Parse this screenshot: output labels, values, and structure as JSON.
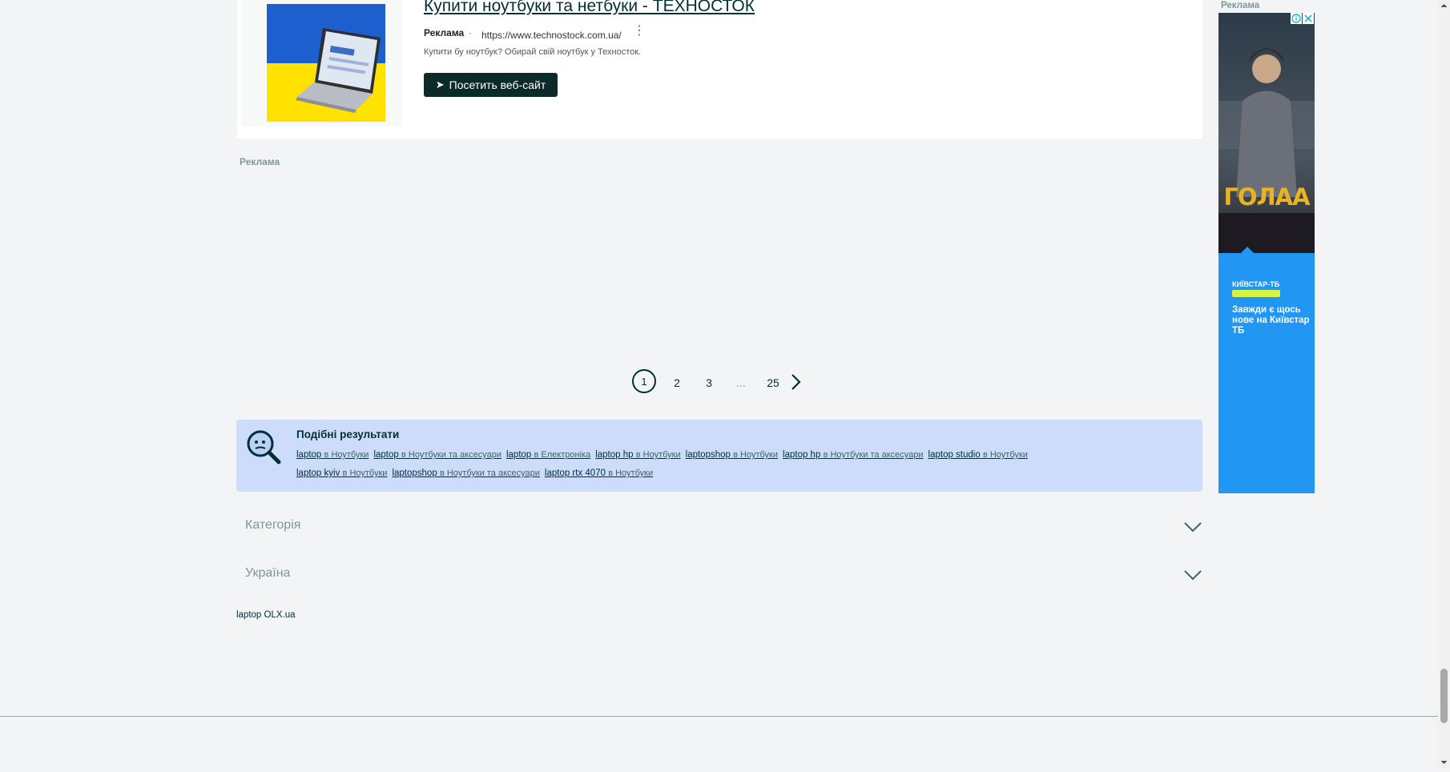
{
  "ad": {
    "title": "Купити ноутбуки та нетбуки - ТЕХНОСТОК",
    "label": "Реклама",
    "separator": "·",
    "url": "https://www.technostock.com.ua/",
    "description": "Купити бу ноутбук? Обирай свій ноутбук у Техносток.",
    "cta": "Посетить веб-сайт",
    "menu_icon": "more-vertical-icon"
  },
  "ad_section_label": "Реклама",
  "pagination": {
    "current": 1,
    "pages": [
      "1",
      "2",
      "3",
      "...",
      "25"
    ],
    "next_icon": "chevron-right-icon"
  },
  "similar": {
    "title": "Подібні результати",
    "icon": "search-face-icon",
    "row1": [
      {
        "q": "laptop",
        "in": "в Ноутбуки"
      },
      {
        "q": "laptop",
        "in": "в Ноутбуки та аксесуари"
      },
      {
        "q": "laptop",
        "in": "в Електроніка"
      },
      {
        "q": "laptop hp",
        "in": "в Ноутбуки"
      },
      {
        "q": "laptopshop",
        "in": "в Ноутбуки"
      },
      {
        "q": "laptop hp",
        "in": "в Ноутбуки та аксесуари"
      },
      {
        "q": "laptop studio",
        "in": "в Ноутбуки"
      }
    ],
    "row2": [
      {
        "q": "laptop kyiv",
        "in": "в Ноутбуки"
      },
      {
        "q": "laptopshop",
        "in": "в Ноутбуки та аксесуари"
      },
      {
        "q": "laptop rtx 4070",
        "in": "в Ноутбуки"
      }
    ]
  },
  "accordions": {
    "category": "Категорія",
    "region": "Україна"
  },
  "footer_link": "laptop OLX.ua",
  "side_ad": {
    "label": "Реклама",
    "poster_title": "ГОЛАА",
    "brand": "КИЇВСТАР-ТБ",
    "text": "Завжди є щось нове на Київстар ТБ",
    "info_icon": "info-icon",
    "close_icon": "close-icon"
  },
  "colors": {
    "background": "#f2f4f5",
    "primary": "#002f34",
    "similar_bg": "#ccdcfa",
    "side_ad_bg": "#2196f3",
    "cta_bg": "#0b2b2b"
  }
}
